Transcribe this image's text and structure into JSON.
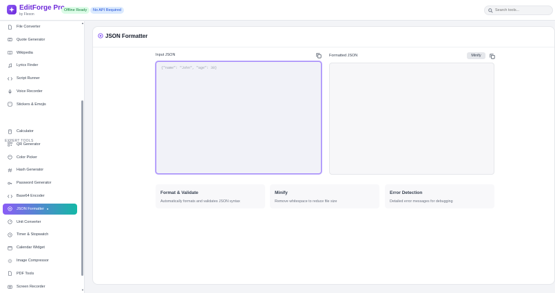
{
  "app": {
    "title": "EditForge Pro",
    "subtitle": "by Flexon",
    "badges": {
      "offline": "Offline Ready",
      "api": "No API Required"
    },
    "search_placeholder": "Search tools..."
  },
  "sidebar": {
    "items_top": [
      {
        "label": "File Converter",
        "icon": "file-icon"
      },
      {
        "label": "Quote Generator",
        "icon": "quote-icon"
      },
      {
        "label": "Wikipedia",
        "icon": "book-icon"
      },
      {
        "label": "Lyrics Finder",
        "icon": "music-icon"
      },
      {
        "label": "Script Runner",
        "icon": "code-icon"
      },
      {
        "label": "Voice Recorder",
        "icon": "mic-icon"
      },
      {
        "label": "Stickers & Emojis",
        "icon": "sticker-icon"
      }
    ],
    "section_label": "EXPERT TOOLS",
    "items_expert": [
      {
        "label": "Calculator",
        "icon": "calculator-icon"
      },
      {
        "label": "QR Generator",
        "icon": "qr-icon"
      },
      {
        "label": "Color Picker",
        "icon": "palette-icon"
      },
      {
        "label": "Hash Generator",
        "icon": "hash-icon"
      },
      {
        "label": "Password Generator",
        "icon": "key-icon"
      },
      {
        "label": "Base64 Encoder",
        "icon": "code-icon"
      },
      {
        "label": "JSON Formatter",
        "icon": "json-icon",
        "active": true
      },
      {
        "label": "Unit Converter",
        "icon": "gauge-icon"
      },
      {
        "label": "Timer & Stopwatch",
        "icon": "clock-icon"
      },
      {
        "label": "Calendar Widget",
        "icon": "calendar-icon"
      },
      {
        "label": "Image Compressor",
        "icon": "compress-icon"
      },
      {
        "label": "PDF Tools",
        "icon": "file-icon"
      },
      {
        "label": "Screen Recorder",
        "icon": "camera-icon"
      }
    ],
    "scroll_position": 0.3
  },
  "main": {
    "title": "JSON Formatter",
    "input_label": "Input JSON",
    "input_placeholder": "{\"name\": \"John\", \"age\": 30}",
    "output_label": "Formatted JSON",
    "minify_label": "Minify",
    "features": [
      {
        "title": "Format & Validate",
        "desc": "Automatically formats and validates JSON syntax"
      },
      {
        "title": "Minify",
        "desc": "Remove whitespace to reduce file size"
      },
      {
        "title": "Error Detection",
        "desc": "Detailed error messages for debugging"
      }
    ]
  },
  "colors": {
    "accent": "#8b5cf6",
    "brand_text": "#6d28d9",
    "active_gradient_end": "#14b8a6",
    "offline_badge": "#dcfce7",
    "api_badge": "#dbeafe"
  }
}
